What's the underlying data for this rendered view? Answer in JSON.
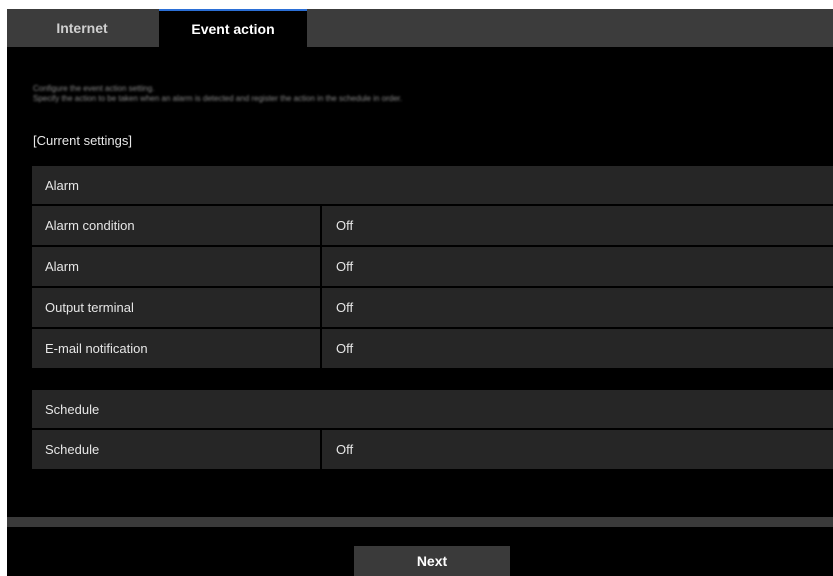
{
  "tabs": [
    {
      "label": "Internet",
      "active": false
    },
    {
      "label": "Event action",
      "active": true
    }
  ],
  "description": {
    "line1": "Configure the event action setting.",
    "line2": "Specify the action to be taken when an alarm is detected and register the action in the schedule in order."
  },
  "current_settings_title": "[Current settings]",
  "alarm_group": {
    "header": "Alarm",
    "rows": [
      {
        "label": "Alarm condition",
        "value": "Off"
      },
      {
        "label": "Alarm",
        "value": "Off"
      },
      {
        "label": "Output terminal",
        "value": "Off"
      },
      {
        "label": "E-mail notification",
        "value": "Off"
      }
    ]
  },
  "schedule_group": {
    "header": "Schedule",
    "rows": [
      {
        "label": "Schedule",
        "value": "Off"
      }
    ]
  },
  "next_button": "Next",
  "colors": {
    "background": "#000000",
    "panel": "#262626",
    "tab_inactive": "#3c3c3c",
    "text": "#e6e6e6"
  }
}
